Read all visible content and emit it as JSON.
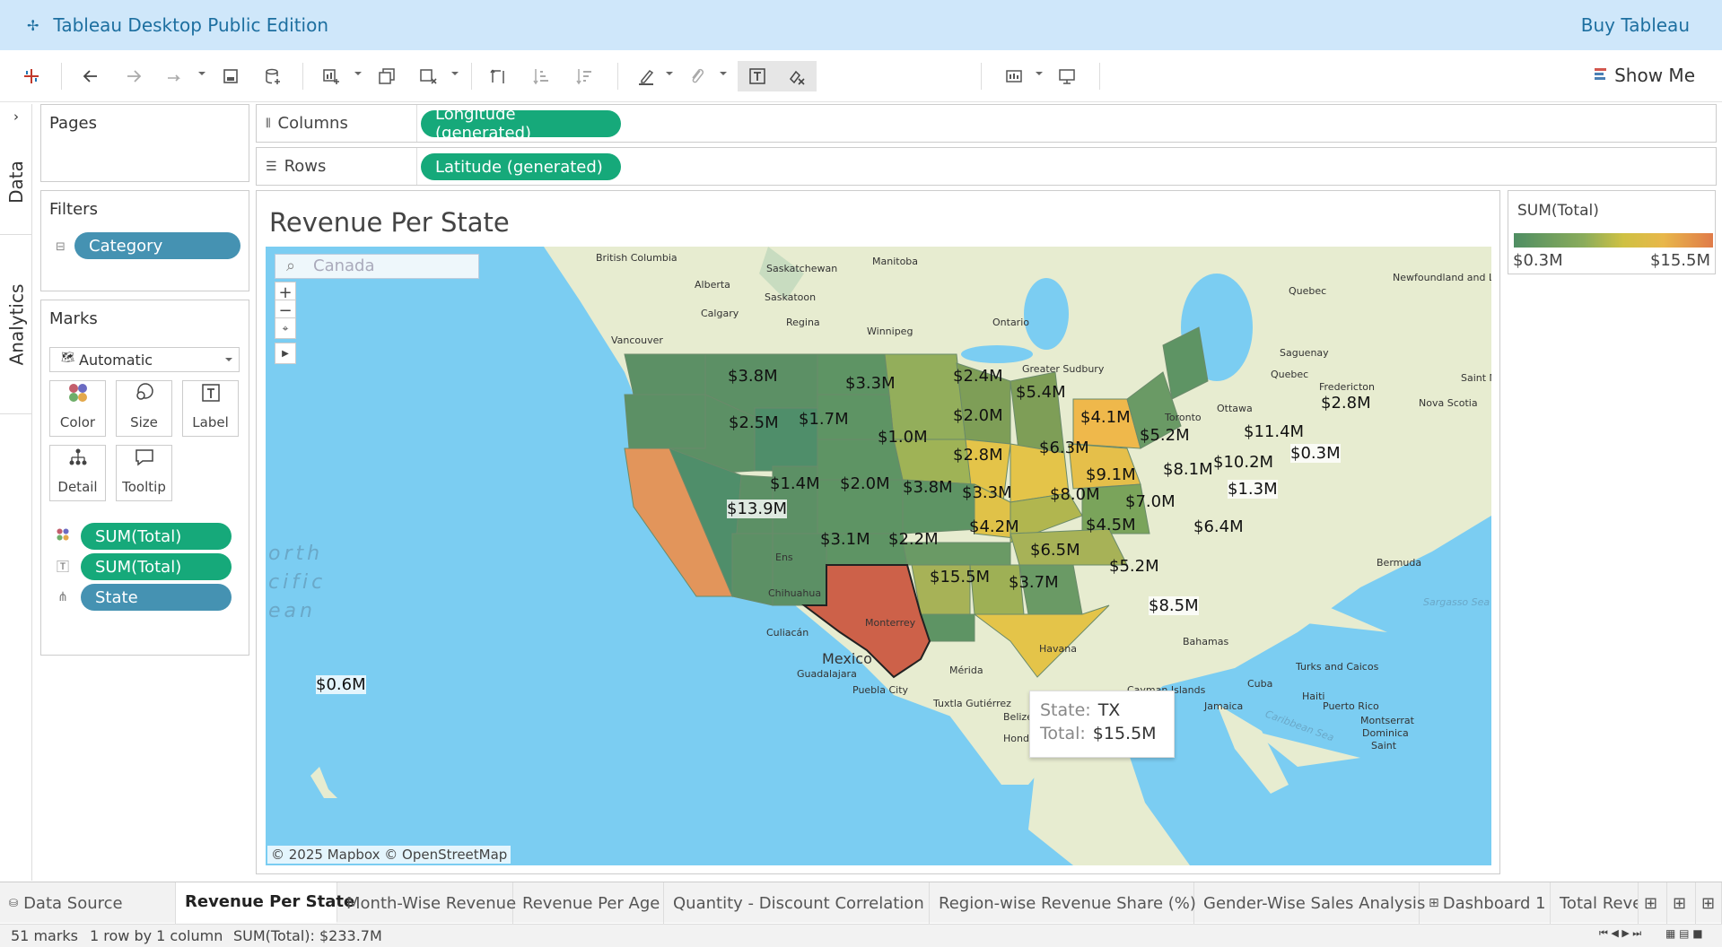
{
  "app": {
    "title": "Tableau Desktop Public Edition",
    "buy_label": "Buy Tableau"
  },
  "toolbar": {
    "show_me_label": "Show Me",
    "dropdown_value": ""
  },
  "side_tabs": {
    "data": "Data",
    "analytics": "Analytics"
  },
  "pages": {
    "title": "Pages"
  },
  "filters": {
    "title": "Filters",
    "items": [
      "Category"
    ]
  },
  "marks": {
    "title": "Marks",
    "type": "Automatic",
    "buttons": [
      "Color",
      "Size",
      "Label",
      "Detail",
      "Tooltip"
    ],
    "fields": [
      {
        "icon": "color-icon",
        "label": "SUM(Total)"
      },
      {
        "icon": "label-icon",
        "label": "SUM(Total)"
      },
      {
        "icon": "detail-icon",
        "label": "State"
      }
    ]
  },
  "shelves": {
    "columns_label": "Columns",
    "columns_pill": "Longitude (generated)",
    "rows_label": "Rows",
    "rows_pill": "Latitude (generated)"
  },
  "viz": {
    "title": "Revenue Per State",
    "search_placeholder": "Canada",
    "copyright": "© 2025 Mapbox © OpenStreetMap",
    "ocean_label": [
      "orth",
      "cific",
      "ean"
    ]
  },
  "map_values": [
    {
      "state": "WA",
      "label": "$3.8M"
    },
    {
      "state": "MT",
      "label": "$3.3M"
    },
    {
      "state": "ND",
      "label": "$2.4M"
    },
    {
      "state": "MN",
      "label": "$5.4M"
    },
    {
      "state": "OR",
      "label": "$2.5M"
    },
    {
      "state": "ID",
      "label": "$1.7M"
    },
    {
      "state": "WY",
      "label": "$1.0M"
    },
    {
      "state": "SD",
      "label": "$2.0M"
    },
    {
      "state": "WI",
      "label": "$4.1M"
    },
    {
      "state": "MI",
      "label": "$5.2M"
    },
    {
      "state": "NY",
      "label": "$11.4M"
    },
    {
      "state": "ME",
      "label": "$2.8M"
    },
    {
      "state": "VT",
      "label": "$0.3M"
    },
    {
      "state": "IA",
      "label": "$6.3M"
    },
    {
      "state": "NE",
      "label": "$2.8M"
    },
    {
      "state": "IL",
      "label": "$9.1M"
    },
    {
      "state": "OH",
      "label": "$8.1M"
    },
    {
      "state": "PA",
      "label": "$10.2M"
    },
    {
      "state": "NV",
      "label": "$1.4M"
    },
    {
      "state": "UT",
      "label": "$2.0M"
    },
    {
      "state": "CO",
      "label": "$3.8M"
    },
    {
      "state": "KS",
      "label": "$3.3M"
    },
    {
      "state": "MO",
      "label": "$8.0M"
    },
    {
      "state": "KY",
      "label": "$7.0M"
    },
    {
      "state": "DE",
      "label": "$1.3M"
    },
    {
      "state": "CA",
      "label": "$13.9M"
    },
    {
      "state": "AZ",
      "label": "$3.1M"
    },
    {
      "state": "NM",
      "label": "$2.2M"
    },
    {
      "state": "OK",
      "label": "$4.2M"
    },
    {
      "state": "TN",
      "label": "$4.5M"
    },
    {
      "state": "NC",
      "label": "$6.4M"
    },
    {
      "state": "AR",
      "label": "$6.5M"
    },
    {
      "state": "GA",
      "label": "$5.2M"
    },
    {
      "state": "TX",
      "label": "$15.5M"
    },
    {
      "state": "LA",
      "label": "$3.7M"
    },
    {
      "state": "FL",
      "label": "$8.5M"
    },
    {
      "state": "HI",
      "label": "$0.6M"
    }
  ],
  "map_places": [
    "British Columbia",
    "Saskatchewan",
    "Manitoba",
    "Alberta",
    "Saskatoon",
    "Quebec",
    "Newfoundland and Labrador",
    "Calgary",
    "Regina",
    "Ontario",
    "Winnipeg",
    "Vancouver",
    "Saguenay",
    "Greater Sudbury",
    "Quebec",
    "Fredericton",
    "Saint Mic",
    "Nova Scotia",
    "Ottawa",
    "Toronto",
    "Bermuda",
    "Sargasso Sea",
    "Chihuahua",
    "Monterrey",
    "Culiacán",
    "Mexico",
    "Guadalajara",
    "Puebla City",
    "Mérida",
    "Bahamas",
    "Havana",
    "Turks and Caicos",
    "Cuba",
    "Haiti",
    "Cayman Islands",
    "Jamaica",
    "Puerto Rico",
    "Tuxtla Gutiérrez",
    "Belize",
    "Honduras",
    "Montserrat",
    "Dominica",
    "Saint",
    "Caribbean Sea",
    "Ens"
  ],
  "tooltip": {
    "state_key": "State:",
    "state_val": "TX",
    "total_key": "Total:",
    "total_val": "$15.5M"
  },
  "legend": {
    "title": "SUM(Total)",
    "min_label": "$0.3M",
    "max_label": "$15.5M",
    "min_color": "#4f8e63",
    "max_color": "#e07b49"
  },
  "sheet_tabs": [
    "Data Source",
    "Revenue Per State",
    "Month-Wise Revenue",
    "Revenue Per Age",
    "Quantity - Discount Correlation",
    "Region-wise Revenue Share (%)",
    "Gender-Wise Sales Analysis",
    "Dashboard 1",
    "Total Reve"
  ],
  "status": {
    "marks": "51 marks",
    "shape": "1 row by 1 column",
    "sum": "SUM(Total): $233.7M"
  }
}
